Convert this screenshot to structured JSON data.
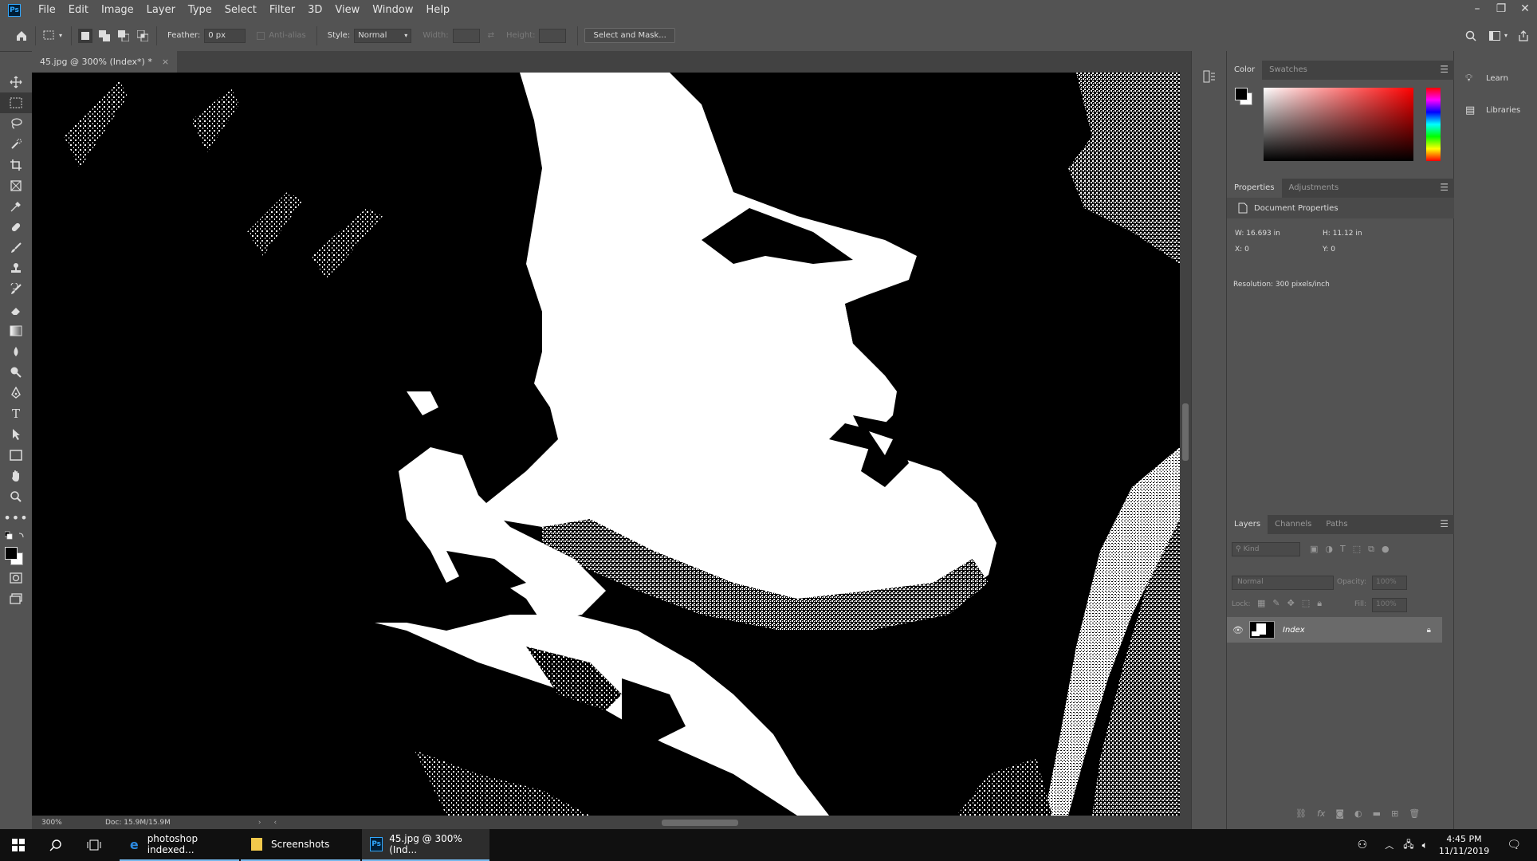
{
  "app": {
    "logo": "Ps"
  },
  "menu": [
    "File",
    "Edit",
    "Image",
    "Layer",
    "Type",
    "Select",
    "Filter",
    "3D",
    "View",
    "Window",
    "Help"
  ],
  "window_controls": {
    "minimize": "–",
    "restore": "❐",
    "close": "✕"
  },
  "options": {
    "feather_label": "Feather:",
    "feather_value": "0 px",
    "antialias_label": "Anti-alias",
    "style_label": "Style:",
    "style_value": "Normal",
    "width_label": "Width:",
    "height_label": "Height:",
    "select_mask_label": "Select and Mask..."
  },
  "document": {
    "tab_title": "45.jpg @ 300% (Index*) *",
    "tab_close": "×"
  },
  "status": {
    "zoom": "300%",
    "doc": "Doc: 15.9M/15.9M"
  },
  "color_panel": {
    "tabs": [
      "Color",
      "Swatches"
    ],
    "foreground": "#000000",
    "background": "#ffffff",
    "hue_accent": "#ff0000"
  },
  "properties_panel": {
    "tabs": [
      "Properties",
      "Adjustments"
    ],
    "title": "Document Properties",
    "w_label": "W:",
    "w_value": "16.693 in",
    "h_label": "H:",
    "h_value": "11.12 in",
    "x_label": "X:",
    "x_value": "0",
    "y_label": "Y:",
    "y_value": "0",
    "resolution": "Resolution: 300 pixels/inch"
  },
  "layers_panel": {
    "tabs": [
      "Layers",
      "Channels",
      "Paths"
    ],
    "kind_placeholder": "Kind",
    "blend_mode": "Normal",
    "opacity_label": "Opacity:",
    "opacity_value": "100%",
    "lock_label": "Lock:",
    "fill_label": "Fill:",
    "fill_value": "100%",
    "layers": [
      {
        "name": "Index"
      }
    ]
  },
  "learn_panel": {
    "items": [
      {
        "label": "Learn",
        "icon": "lightbulb-icon"
      },
      {
        "label": "Libraries",
        "icon": "libraries-icon"
      }
    ]
  },
  "taskbar": {
    "apps": [
      {
        "label": "photoshop indexed...",
        "icon": "edge-icon"
      },
      {
        "label": "Screenshots",
        "icon": "folder-icon"
      },
      {
        "label": "45.jpg @ 300% (Ind...",
        "icon": "photoshop-icon"
      }
    ],
    "time": "4:45 PM",
    "date": "11/11/2019"
  }
}
